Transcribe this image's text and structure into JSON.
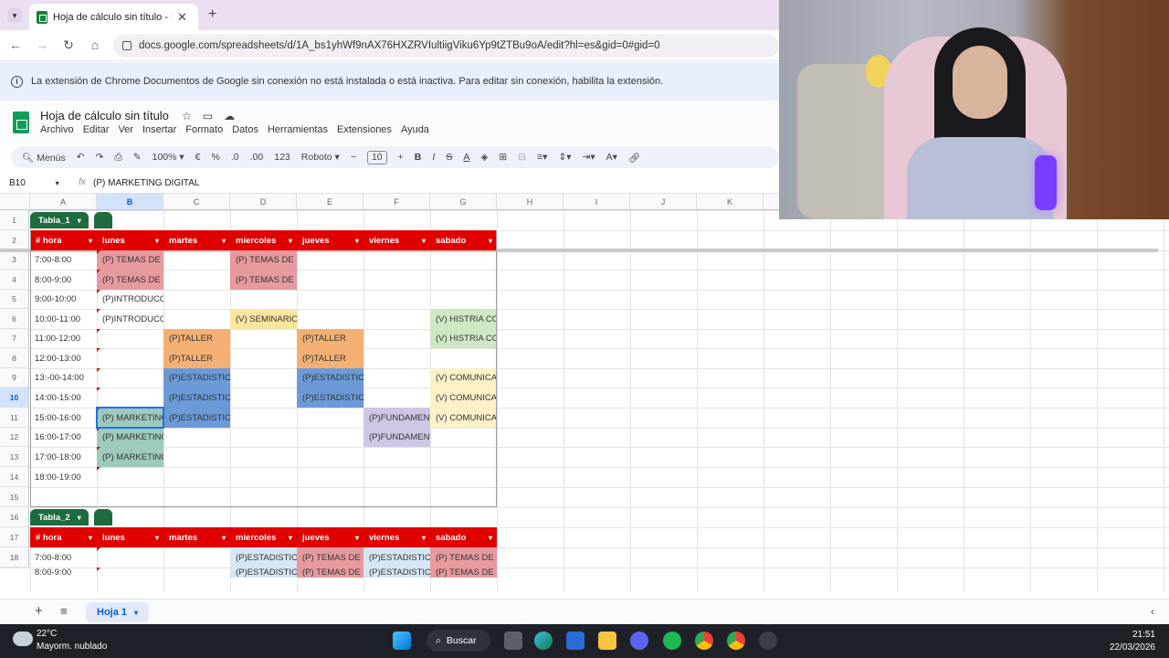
{
  "browser": {
    "tab_title": "Hoja de cálculo sin título - Hoja",
    "url": "docs.google.com/spreadsheets/d/1A_bs1yhWf9nAX76HXZRVIultiigViku6Yp9tZTBu9oA/edit?hl=es&gid=0#gid=0"
  },
  "banner": {
    "text": "La extensión de Chrome Documentos de Google sin conexión no está instalada o está inactiva. Para editar sin conexión, habilita la extensión."
  },
  "doc": {
    "title": "Hoja de cálculo sin título",
    "menus": [
      "Archivo",
      "Editar",
      "Ver",
      "Insertar",
      "Formato",
      "Datos",
      "Herramientas",
      "Extensiones",
      "Ayuda"
    ]
  },
  "toolbar": {
    "search": "Menús",
    "zoom": "100%",
    "currency": "€",
    "percent": "%",
    "dec_less": ".0",
    "dec_more": ".00",
    "format_num": "123",
    "font": "Roboto",
    "font_size": "10"
  },
  "formula_bar": {
    "cell_ref": "B10",
    "fx": "fx",
    "value": "(P) MARKETING DIGITAL"
  },
  "columns": [
    "A",
    "B",
    "C",
    "D",
    "E",
    "F",
    "G",
    "H",
    "I",
    "J",
    "K"
  ],
  "rows": [
    "1",
    "2",
    "3",
    "4",
    "5",
    "6",
    "7",
    "8",
    "9",
    "10",
    "11",
    "12",
    "13",
    "14",
    "15",
    "16",
    "17",
    "18"
  ],
  "tabla1": {
    "name": "Tabla_1",
    "headers": [
      "#  hora",
      "lunes",
      "martes",
      "miercoles",
      "jueves",
      "viernes",
      "sabado"
    ],
    "hours": [
      "7:00-8:00",
      "8:00-9:00",
      "9:00-10:00",
      "10:00-11:00",
      "11:00-12:00",
      "12:00-13:00",
      "13:-00-14:00",
      "14:00-15:00",
      "15:00-16:00",
      "16:00-17:00",
      "17:00-18:00",
      "18:00-19:00"
    ],
    "cells": [
      [
        "(P) TEMAS DE H",
        "",
        "(P) TEMAS DE H",
        "",
        "",
        ""
      ],
      [
        "(P) TEMAS DE H",
        "",
        "(P) TEMAS DE H",
        "",
        "",
        ""
      ],
      [
        "(P)INTRODUCCI",
        "",
        "",
        "",
        "",
        ""
      ],
      [
        "(P)INTRODUCCI",
        "",
        "(V) SEMINARIO",
        "",
        "",
        "(V) HISTRIA CO"
      ],
      [
        "",
        "(P)TALLER",
        "",
        "(P)TALLER",
        "",
        "(V) HISTRIA CO"
      ],
      [
        "",
        "(P)TALLER",
        "",
        "(P)TALLER",
        "",
        ""
      ],
      [
        "",
        "(P)ESTADISTICA",
        "",
        "(P)ESTADISTICA",
        "",
        "(V) COMUNICAC"
      ],
      [
        "",
        "(P)ESTADISTICA",
        "",
        "(P)ESTADISTICA",
        "",
        "(V) COMUNICAC"
      ],
      [
        "(P) MARKETING",
        "(P)ESTADISTICA",
        "",
        "",
        "(P)FUNDAMENT",
        "(V) COMUNICAC"
      ],
      [
        "(P) MARKETING",
        "",
        "",
        "",
        "(P)FUNDAMENT",
        ""
      ],
      [
        "(P) MARKETING",
        "",
        "",
        "",
        "",
        ""
      ],
      [
        "",
        "",
        "",
        "",
        "",
        ""
      ]
    ]
  },
  "tabla2": {
    "name": "Tabla_2",
    "headers": [
      "#  hora",
      "lunes",
      "martes",
      "miercoles",
      "jueves",
      "viernes",
      "sabado"
    ],
    "hours": [
      "7:00-8:00",
      "8:00-9:00"
    ],
    "cells": [
      [
        "",
        "",
        "(P)ESTADISTICA",
        "(P) TEMAS DE H",
        "(P)ESTADISTICA",
        "(P) TEMAS DE H"
      ],
      [
        "",
        "",
        "(P)ESTADISTICA",
        "(P) TEMAS DE H",
        "(P)ESTADISTICA",
        "(P) TEMAS DE H"
      ]
    ]
  },
  "sheet_tab": "Hoja 1",
  "taskbar": {
    "temp": "22°C",
    "weather": "Mayorm. nublado",
    "search": "Buscar",
    "time": "21:51",
    "date": "22/03/2026"
  },
  "colors": {
    "header_red": "#e00000",
    "table_green": "#1e6b3f",
    "pink": "#e69a9e",
    "orange": "#f4b072",
    "blue": "#6c9ad8",
    "teal": "#9ec9bd",
    "yellow": "#fbe6a0",
    "green_light": "#cfe8c4",
    "lavender": "#cfc6e6",
    "yellow_light": "#fdf1c8",
    "ice": "#d6e6f4"
  }
}
